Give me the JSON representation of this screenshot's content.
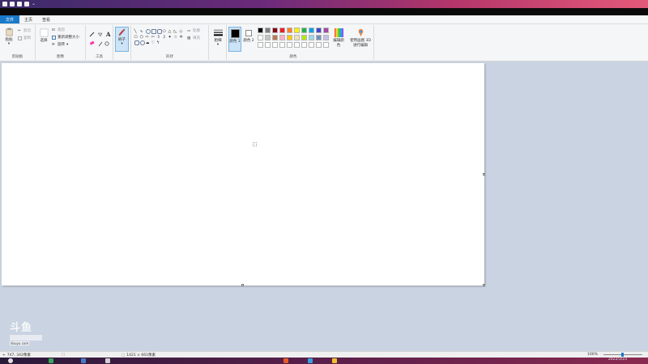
{
  "ribbon_tabs": [
    "文件",
    "主页",
    "查看"
  ],
  "clipboard": {
    "paste": "粘贴",
    "cut": "剪切",
    "copy": "复制",
    "label": "剪贴板"
  },
  "image": {
    "select": "选择",
    "crop": "裁剪",
    "resize": "重新调整大小",
    "rotate": "旋转",
    "label": "图像"
  },
  "tools": {
    "label": "工具"
  },
  "brush": {
    "label": "刷子"
  },
  "shapes": {
    "outline": "轮廓",
    "fill": "填充",
    "label": "形状"
  },
  "size": {
    "label": "粗细"
  },
  "color1": {
    "label": "颜色 1"
  },
  "color2": {
    "label": "颜色 2"
  },
  "edit_colors": {
    "label": "编辑颜色"
  },
  "paint3d": {
    "label": "使用画图 3D 进行编辑"
  },
  "colors_group": {
    "label": "颜色"
  },
  "palette": {
    "row1": [
      "#000000",
      "#7f7f7f",
      "#880015",
      "#ed1c24",
      "#ff7f27",
      "#fff200",
      "#22b14c",
      "#00a2e8",
      "#3f48cc",
      "#a349a4"
    ],
    "row2": [
      "#ffffff",
      "#c3c3c3",
      "#b97a57",
      "#ffaec9",
      "#ffc90e",
      "#efe4b0",
      "#b5e61d",
      "#99d9ea",
      "#7092be",
      "#c8bfe7"
    ],
    "row3": [
      "#ffffff",
      "#ffffff",
      "#ffffff",
      "#ffffff",
      "#ffffff",
      "#ffffff",
      "#ffffff",
      "#ffffff",
      "#ffffff",
      "#ffffff"
    ]
  },
  "status": {
    "cursor_pos": "747, 342像素",
    "canvas_size": "1421 × 661像素",
    "zoom": "100%"
  },
  "watermark": {
    "logo": "斗鱼",
    "url": "douyu.com"
  },
  "taskbar": {
    "date": "2022/3/23"
  }
}
